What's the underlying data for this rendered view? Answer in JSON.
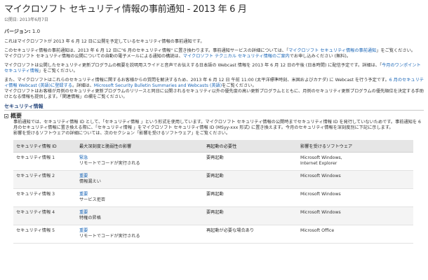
{
  "header": {
    "title": "マイクロソフト セキュリティ情報の事前通知 - 2013 年 6 月",
    "published": "公開日: 2013年6月7日",
    "version_label": "バージョン:",
    "version_value": "1.0"
  },
  "intro": {
    "p1": "これはマイクロソフトが 2013 年 6 月 12 日に公開を予定しているセキュリティ情報の事前通知です。",
    "p2a": "このセキュリティ情報の事前通知は、2013 年 6 月 12 日に\"6 月のセキュリティ情報\" に置き換わります。事前通知サービスの詳細については、「",
    "p2_link": "マイクロソフト セキュリティ情報の事前通知",
    "p2b": "」をご覧ください。",
    "p3a": "マイクロソフト セキュリティ情報の公開についての自動の電子メールによる通知の構読は、",
    "p3_link": "マイクロソフト テクニカル セキュリティ情報のご案内",
    "p3b": "でお申し込みください (無料)。",
    "p4a": "マイクロソフトは公開したセキュリティ更新プログラムの概要を説明用スライドと音声でお伝えする日本語の Webcast 情報を 2013 年 6 月 12 日の午後 (日本時間) に配信予定です。詳細は、「",
    "p4_link": "今月のワンポイント セキュリティ情報",
    "p4b": "」をご覧ください。",
    "p5a": "また、マイクロソフトはこれらのセキュリティ情報に関するお客様からの質問を解決するため、2013 年 6 月 12 日 午前 11:00 (太平洋標準時刻、米国およびカナダ) に Webcast を行う予定です。",
    "p5_link1": "6 月のセキュリティ情報 Webcast (英語)に登録する",
    "p5b": "。詳細は、",
    "p5_link2": "Microsoft Security Bulletin Summaries and Webcasts (英語)",
    "p5c": "をご覧ください。",
    "p6": "マイクロソフトはお客様が月例のセキュリティ更新プログラムのリリースと同日に公開されるセキュリティ以外の優先度の高い更新プログラムとともに、月例のセキュリティ更新プログラムの優先順位を決定する手助けとなる情報も提供します。「関連情報」の欄をご覧ください。"
  },
  "section": {
    "bar_title": "セキュリティ情報",
    "sub_title": "概要",
    "desc1": "事前通知では、セキュリティ情報 ID として、「セキュリティ情報 」という形式を使用しています。マイクロソフト セキュリティ情報の公開時までセキュリティ情報 ID を発行していないためです。事前通知を 6 月のセキュリティ情報に置き換える際に、「セキュリティ情報 」をマイクロソフト セキュリティ情報 ID (MSyy-xxx 形式) に置き換えます。今月のセキュリティ情報を深刻度別に下記に示します。",
    "desc2": "影響を受けるソフトウェアの詳細については、次のセクション「影響を受けるソフトウェア」をご覧ください。"
  },
  "table": {
    "headers": [
      "セキュリティ情報 ID",
      "最大深刻度と脆弱性の影響",
      "再起動の必要性",
      "影響を受けるソフトウェア"
    ],
    "rows": [
      {
        "id": "セキュリティ情報 1",
        "severity": "緊急",
        "impact": "リモートでコードが実行される",
        "restart": "要再起動",
        "software1": "Microsoft Windows,",
        "software2": "Internet Explorer"
      },
      {
        "id": "セキュリティ情報 2",
        "severity": "重要",
        "impact": "情報漏えい",
        "restart": "要再起動",
        "software1": "Microsoft Windows",
        "software2": ""
      },
      {
        "id": "セキュリティ情報 3",
        "severity": "重要",
        "impact": "サービス拒否",
        "restart": "要再起動",
        "software1": "Microsoft Windows",
        "software2": ""
      },
      {
        "id": "セキュリティ情報 4",
        "severity": "重要",
        "impact": "特権の昇格",
        "restart": "要再起動",
        "software1": "Microsoft Windows",
        "software2": ""
      },
      {
        "id": "セキュリティ情報 5",
        "severity": "重要",
        "impact": "リモートでコードが実行される",
        "restart": "再起動が必要な場合あり",
        "software1": "Microsoft Office",
        "software2": ""
      }
    ]
  },
  "colors": {
    "link": "#1a66b7",
    "header_bg": "#e6e6e6",
    "section_title": "#2a4a7f"
  }
}
